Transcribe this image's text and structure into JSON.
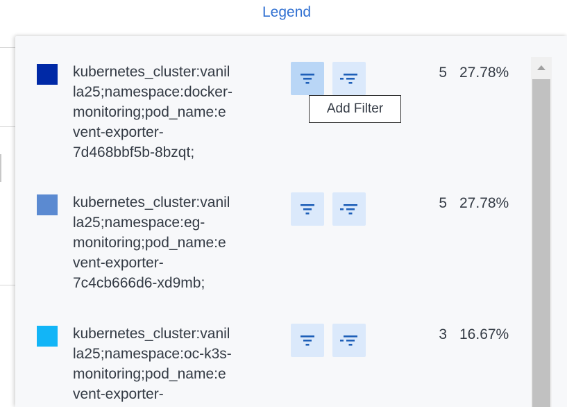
{
  "legend_link": "Legend",
  "tooltip": "Add Filter",
  "items": [
    {
      "color": "#0029a6",
      "label": "kubernetes_cluster:vanil\nla25;namespace:docker-\nmonitoring;pod_name:e\nvent-exporter-\n7d468bbf5b-8bzqt;",
      "count": "5",
      "percent": "27.78%"
    },
    {
      "color": "#5b8ad1",
      "label": "kubernetes_cluster:vanil\nla25;namespace:eg-\nmonitoring;pod_name:e\nvent-exporter-\n7c4cb666d6-xd9mb;",
      "count": "5",
      "percent": "27.78%"
    },
    {
      "color": "#12b5f7",
      "label": "kubernetes_cluster:vanil\nla25;namespace:oc-k3s-\nmonitoring;pod_name:e\nvent-exporter-",
      "count": "3",
      "percent": "16.67%"
    }
  ],
  "icons": {
    "include_filter": "filter-icon",
    "exclude_filter": "filter-exclude-icon",
    "scroll_up": "caret-up-icon"
  },
  "colors": {
    "link": "#2f6fd1",
    "button_bg": "#dbe9fb",
    "button_hover": "#b9d6f6",
    "icon": "#1e5fb8",
    "panel_bg": "#f7f8fa"
  }
}
